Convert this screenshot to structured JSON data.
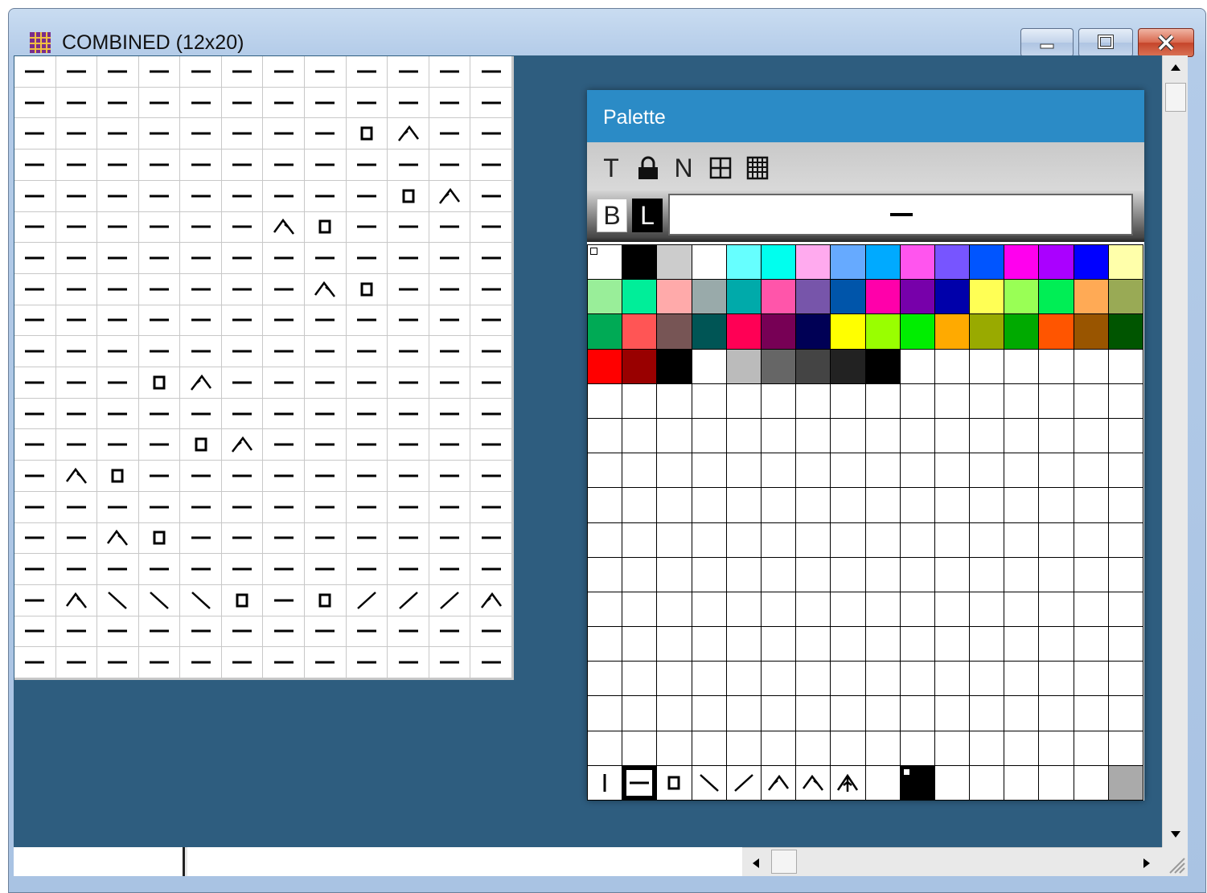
{
  "window": {
    "title": "COMBINED (12x20)"
  },
  "palette": {
    "title": "Palette",
    "tools": [
      {
        "label": "T",
        "icon": "text-tool-icon"
      },
      {
        "label": "",
        "icon": "lock-icon"
      },
      {
        "label": "N",
        "icon": "n-tool-icon"
      },
      {
        "label": "",
        "icon": "grid-small-icon"
      },
      {
        "label": "",
        "icon": "grid-large-icon"
      }
    ],
    "bg_button": "B",
    "line_button": "L",
    "current_symbol": "purl",
    "colors": [
      "#ffffff",
      "#000000",
      "#cccccc",
      "#ffffff",
      "#66ffff",
      "#00ffee",
      "#ffaaee",
      "#66aaff",
      "#00aaff",
      "#ff55ee",
      "#7755ff",
      "#0055ff",
      "#ff00ee",
      "#aa00ff",
      "#0000ff",
      "#ffffaa",
      "#99ee99",
      "#00ee99",
      "#ffaaaa",
      "#99aaaa",
      "#00aaaa",
      "#ff55aa",
      "#7755aa",
      "#0055aa",
      "#ff00aa",
      "#7700aa",
      "#0000aa",
      "#ffff55",
      "#99ff55",
      "#00ee55",
      "#ffaa55",
      "#99aa55",
      "#00aa55",
      "#ff5555",
      "#775555",
      "#005555",
      "#ff0055",
      "#770055",
      "#000055",
      "#ffff00",
      "#99ff00",
      "#00ee00",
      "#ffaa00",
      "#99aa00",
      "#00aa00",
      "#ff5500",
      "#995500",
      "#005500",
      "#ff0000",
      "#990000",
      "#000000",
      "#ffffff",
      "#bbbbbb",
      "#666666",
      "#444444",
      "#222222",
      "#000000"
    ],
    "symbol_row": [
      "knit",
      "purl",
      "yo",
      "ssk",
      "k2tog",
      "sk2po-left",
      "sk2po-right",
      "cdd",
      "",
      "selected-marker",
      "",
      "",
      "",
      "",
      "",
      "gray-end"
    ]
  },
  "chart": {
    "columns": 12,
    "rows": [
      [
        "-",
        "-",
        "-",
        "-",
        "-",
        "-",
        "-",
        "-",
        "-",
        "-",
        "-",
        "-"
      ],
      [
        "-",
        "-",
        "-",
        "-",
        "-",
        "-",
        "-",
        "-",
        "-",
        "-",
        "-",
        "-"
      ],
      [
        "-",
        "-",
        "-",
        "-",
        "-",
        "-",
        "-",
        "-",
        "O",
        "<",
        "-",
        "-"
      ],
      [
        "-",
        "-",
        "-",
        "-",
        "-",
        "-",
        "-",
        "-",
        "-",
        "-",
        "-",
        "-"
      ],
      [
        "-",
        "-",
        "-",
        "-",
        "-",
        "-",
        "-",
        "-",
        "-",
        "O",
        "<",
        "-"
      ],
      [
        "-",
        "-",
        "-",
        "-",
        "-",
        "-",
        ">",
        "O",
        "-",
        "-",
        "-",
        "-"
      ],
      [
        "-",
        "-",
        "-",
        "-",
        "-",
        "-",
        "-",
        "-",
        "-",
        "-",
        "-",
        "-"
      ],
      [
        "-",
        "-",
        "-",
        "-",
        "-",
        "-",
        "-",
        ">",
        "O",
        "-",
        "-",
        "-"
      ],
      [
        "-",
        "-",
        "-",
        "-",
        "-",
        "-",
        "-",
        "-",
        "-",
        "-",
        "-",
        "-"
      ],
      [
        "-",
        "-",
        "-",
        "-",
        "-",
        "-",
        "-",
        "-",
        "-",
        "-",
        "-",
        "-"
      ],
      [
        "-",
        "-",
        "-",
        "O",
        "<",
        "-",
        "-",
        "-",
        "-",
        "-",
        "-",
        "-"
      ],
      [
        "-",
        "-",
        "-",
        "-",
        "-",
        "-",
        "-",
        "-",
        "-",
        "-",
        "-",
        "-"
      ],
      [
        "-",
        "-",
        "-",
        "-",
        "O",
        "<",
        "-",
        "-",
        "-",
        "-",
        "-",
        "-"
      ],
      [
        "-",
        ">",
        "O",
        "-",
        "-",
        "-",
        "-",
        "-",
        "-",
        "-",
        "-",
        "-"
      ],
      [
        "-",
        "-",
        "-",
        "-",
        "-",
        "-",
        "-",
        "-",
        "-",
        "-",
        "-",
        "-"
      ],
      [
        "-",
        "-",
        ">",
        "O",
        "-",
        "-",
        "-",
        "-",
        "-",
        "-",
        "-",
        "-"
      ],
      [
        "-",
        "-",
        "-",
        "-",
        "-",
        "-",
        "-",
        "-",
        "-",
        "-",
        "-",
        "-"
      ],
      [
        "-",
        ">",
        "\\",
        "\\",
        "\\",
        "O",
        "-",
        "O",
        "/",
        "/",
        "/",
        "<"
      ],
      [
        "-",
        "-",
        "-",
        "-",
        "-",
        "-",
        "-",
        "-",
        "-",
        "-",
        "-",
        "-"
      ],
      [
        "-",
        "-",
        "-",
        "-",
        "-",
        "-",
        "-",
        "-",
        "-",
        "-",
        "-",
        "-"
      ]
    ]
  },
  "colors": {
    "client_bg": "#2e5d7f",
    "palette_title": "#2b8bc6",
    "grid_line": "#c8c8c8"
  }
}
